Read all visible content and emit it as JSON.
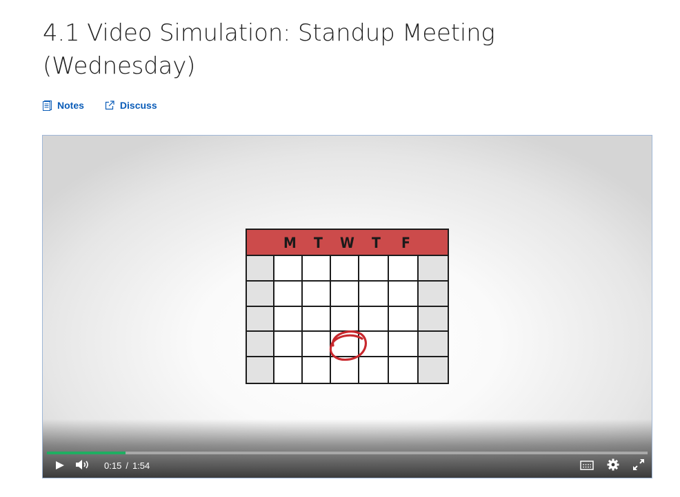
{
  "page": {
    "title": "4.1 Video Simulation: Standup Meeting (Wednesday)"
  },
  "actions": [
    {
      "label": "Notes",
      "icon": "notes-icon"
    },
    {
      "label": "Discuss",
      "icon": "external-link-icon"
    }
  ],
  "video": {
    "calendar_days": [
      "M",
      "T",
      "W",
      "T",
      "F"
    ],
    "current_time": "0:15",
    "separator": "/",
    "duration": "1:54",
    "progress_fraction": 0.131,
    "controls": [
      "play-icon",
      "volume-icon",
      "captions-icon",
      "settings-icon",
      "fullscreen-icon"
    ]
  },
  "colors": {
    "link": "#0a5cb8",
    "calendar_header": "#cc4b4b",
    "progress": "#1fae62",
    "circle": "#c8282d"
  }
}
